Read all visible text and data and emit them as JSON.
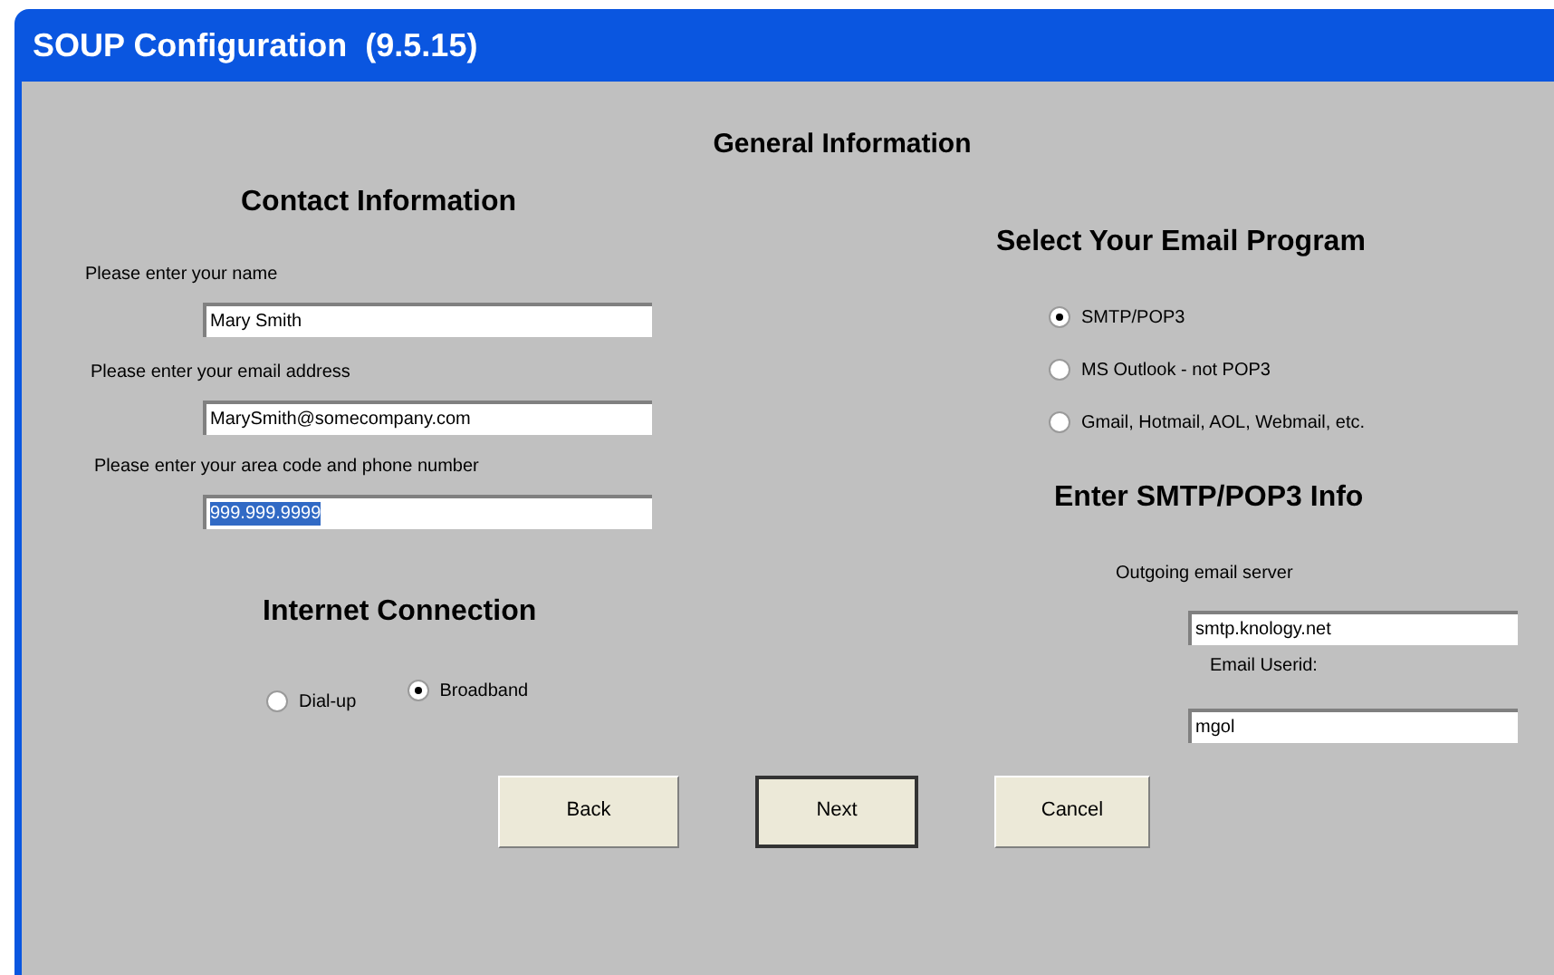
{
  "window": {
    "title": "SOUP Configuration  (9.5.15)"
  },
  "heading": "General Information",
  "contact": {
    "heading": "Contact Information",
    "fields": [
      {
        "label": "Please enter your name",
        "value": "Mary Smith",
        "text_selected": false
      },
      {
        "label": "Please enter your email address",
        "value": "MarySmith@somecompany.com",
        "text_selected": false
      },
      {
        "label": "Please enter your area code and phone number",
        "value": "999.999.9999",
        "text_selected": true
      }
    ]
  },
  "connection": {
    "heading": "Internet Connection",
    "options": [
      {
        "label": "Dial-up",
        "selected": false
      },
      {
        "label": "Broadband",
        "selected": true
      }
    ]
  },
  "email_program": {
    "heading": "Select Your Email Program",
    "options": [
      {
        "label": "SMTP/POP3",
        "selected": true
      },
      {
        "label": "MS Outlook - not POP3",
        "selected": false
      },
      {
        "label": "Gmail, Hotmail, AOL, Webmail, etc.",
        "selected": false
      }
    ]
  },
  "smtp": {
    "heading": "Enter SMTP/POP3 Info",
    "fields": [
      {
        "label": "Outgoing email server",
        "value": "smtp.knology.net"
      },
      {
        "label": "Email Userid:",
        "value": "mgol"
      }
    ]
  },
  "buttons": [
    {
      "label": "Back",
      "default": false
    },
    {
      "label": "Next",
      "default": true
    },
    {
      "label": "Cancel",
      "default": false
    }
  ]
}
